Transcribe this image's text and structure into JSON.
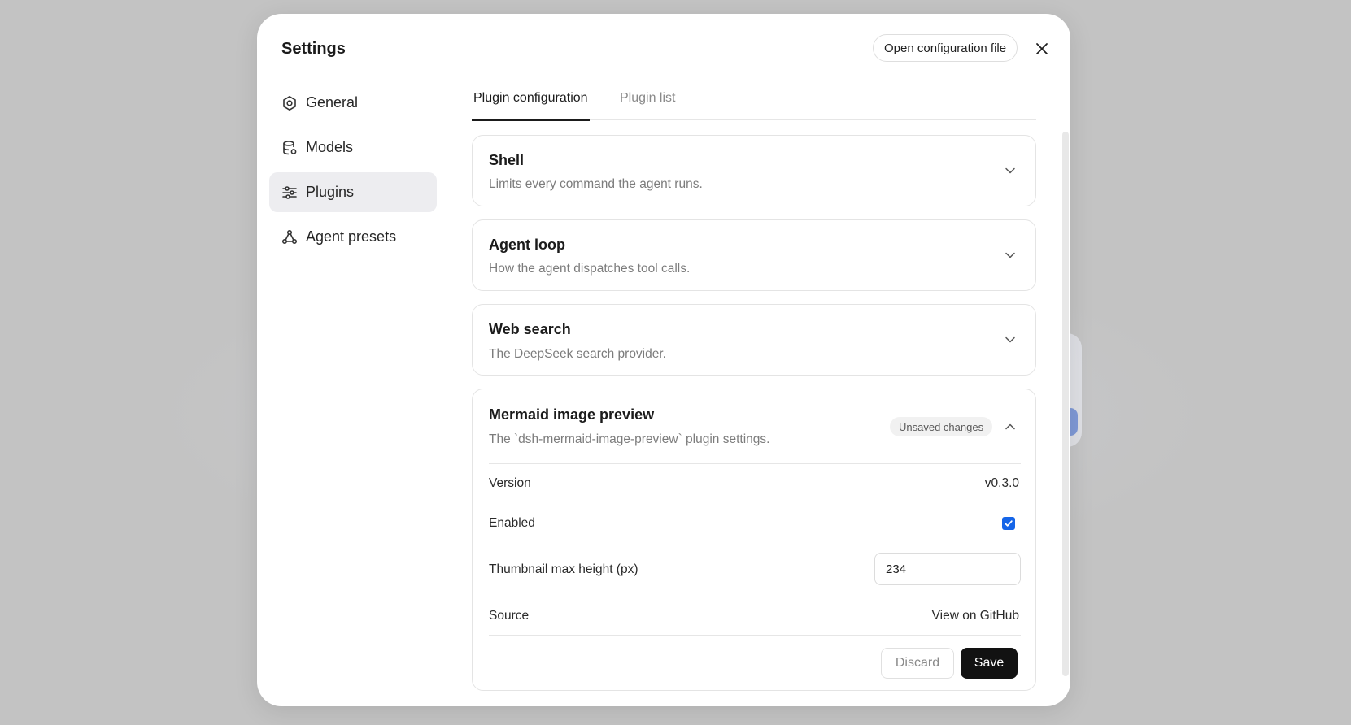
{
  "modal": {
    "title": "Settings",
    "open_config_label": "Open configuration file"
  },
  "sidebar": {
    "items": [
      {
        "label": "General",
        "icon": "gear-icon",
        "active": false
      },
      {
        "label": "Models",
        "icon": "database-icon",
        "active": false
      },
      {
        "label": "Plugins",
        "icon": "sliders-icon",
        "active": true
      },
      {
        "label": "Agent presets",
        "icon": "presets-icon",
        "active": false
      }
    ]
  },
  "tabs": [
    {
      "label": "Plugin configuration",
      "active": true
    },
    {
      "label": "Plugin list",
      "active": false
    }
  ],
  "plugins": [
    {
      "title": "Shell",
      "description": "Limits every command the agent runs.",
      "expanded": false
    },
    {
      "title": "Agent loop",
      "description": "How the agent dispatches tool calls.",
      "expanded": false
    },
    {
      "title": "Web search",
      "description": "The DeepSeek search provider.",
      "expanded": false
    },
    {
      "title": "Mermaid image preview",
      "description": "The `dsh-mermaid-image-preview` plugin settings.",
      "expanded": true,
      "badge": "Unsaved changes",
      "fields": {
        "version_label": "Version",
        "version_value": "v0.3.0",
        "enabled_label": "Enabled",
        "enabled": true,
        "thumb_label": "Thumbnail max height (px)",
        "thumb_value": "234",
        "source_label": "Source",
        "source_link": "View on GitHub"
      },
      "actions": {
        "discard_label": "Discard",
        "save_label": "Save"
      }
    }
  ],
  "colors": {
    "accent_checkbox": "#1565e8",
    "save_button": "#121212",
    "backdrop": "#c3c3c3"
  }
}
